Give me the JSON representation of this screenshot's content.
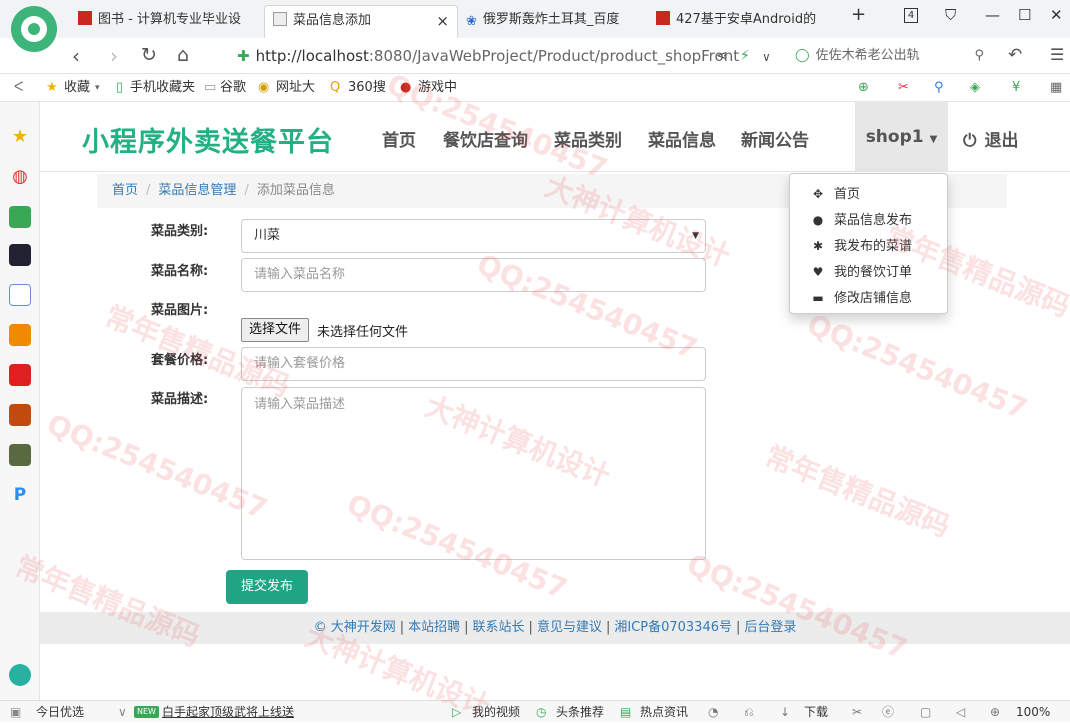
{
  "browser": {
    "tabs": [
      {
        "label": "图书 - 计算机专业毕业设"
      },
      {
        "label": "菜品信息添加",
        "close": "×"
      },
      {
        "label": "俄罗斯轰炸土耳其_百度"
      },
      {
        "label": "427基于安卓Android的"
      }
    ],
    "new_tab": "+",
    "tab_count": "4",
    "url_host": "http://localhost",
    "url_path": ":8080/JavaWebProject/Product/product_shopFront",
    "search_text": "佐佐木希老公出轨"
  },
  "bookmarks": [
    {
      "label": "收藏"
    },
    {
      "label": "手机收藏夹"
    },
    {
      "label": "谷歌"
    },
    {
      "label": "网址大"
    },
    {
      "label": "360搜"
    },
    {
      "label": "游戏中"
    }
  ],
  "site": {
    "brand": "小程序外卖送餐平台",
    "nav": [
      "首页",
      "餐饮店查询",
      "菜品类别",
      "菜品信息",
      "新闻公告"
    ],
    "user_menu": "shop1",
    "logout": "退出",
    "breadcrumb": [
      "首页",
      "菜品信息管理",
      "添加菜品信息"
    ],
    "dropdown": [
      {
        "label": "首页",
        "icon": "move-icon"
      },
      {
        "label": "菜品信息发布",
        "icon": "user-icon"
      },
      {
        "label": "我发布的菜谱",
        "icon": "cog-icon"
      },
      {
        "label": "我的餐饮订单",
        "icon": "heart-icon"
      },
      {
        "label": "修改店铺信息",
        "icon": "card-icon"
      }
    ]
  },
  "form": {
    "category_label": "菜品类别:",
    "category_value": "川菜",
    "name_label": "菜品名称:",
    "name_placeholder": "请输入菜品名称",
    "image_label": "菜品图片:",
    "file_button": "选择文件",
    "file_status": "未选择任何文件",
    "price_label": "套餐价格:",
    "price_placeholder": "请输入套餐价格",
    "desc_label": "菜品描述:",
    "desc_placeholder": "请输入菜品描述",
    "submit": "提交发布"
  },
  "footer": {
    "items": [
      "© 大神开发网",
      "本站招聘",
      "联系站长",
      "意见与建议",
      "湘ICP备0703346号",
      "后台登录"
    ]
  },
  "statusbar": {
    "left": "今日优选",
    "news_badge": "NEW",
    "news": "白手起家顶级武将上线送",
    "video": "我的视频",
    "headlines": "头条推荐",
    "hot": "热点资讯",
    "download": "下载",
    "zoom": "100%"
  },
  "watermark": {
    "qq": "QQ:254540457",
    "a": "大神计算机设计",
    "b": "常年售精品源码"
  },
  "colors": {
    "brand": "#23b083",
    "submit": "#1fa584",
    "link": "#337ab7"
  }
}
